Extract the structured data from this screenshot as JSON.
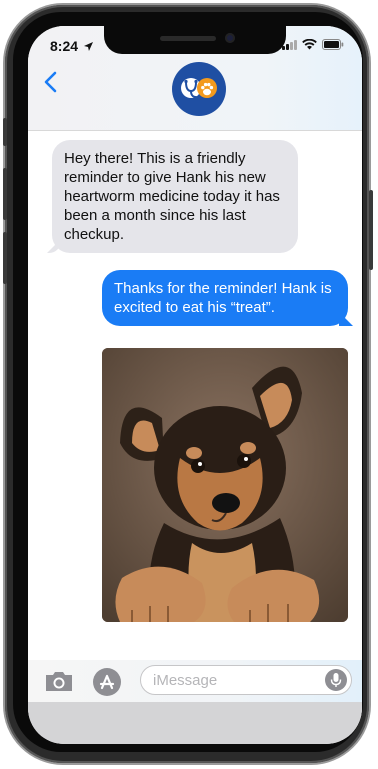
{
  "status_bar": {
    "time": "8:24"
  },
  "header": {
    "contact_avatar_icon": "vet-stethoscope-paw-icon"
  },
  "messages": [
    {
      "direction": "incoming",
      "text": "Hey there! This is a friendly reminder to give Hank his new heartworm medicine today it has been a month since his last checkup."
    },
    {
      "direction": "outgoing",
      "text": "Thanks for the reminder! Hank is excited to eat his “treat”."
    },
    {
      "direction": "outgoing",
      "type": "photo",
      "subject": "puppy"
    }
  ],
  "input": {
    "placeholder": "iMessage"
  },
  "colors": {
    "outgoing_bubble": "#1a7cf5",
    "incoming_bubble": "#e5e5ea",
    "avatar_bg": "#1f4fa3",
    "accent": "#f39a1e"
  }
}
